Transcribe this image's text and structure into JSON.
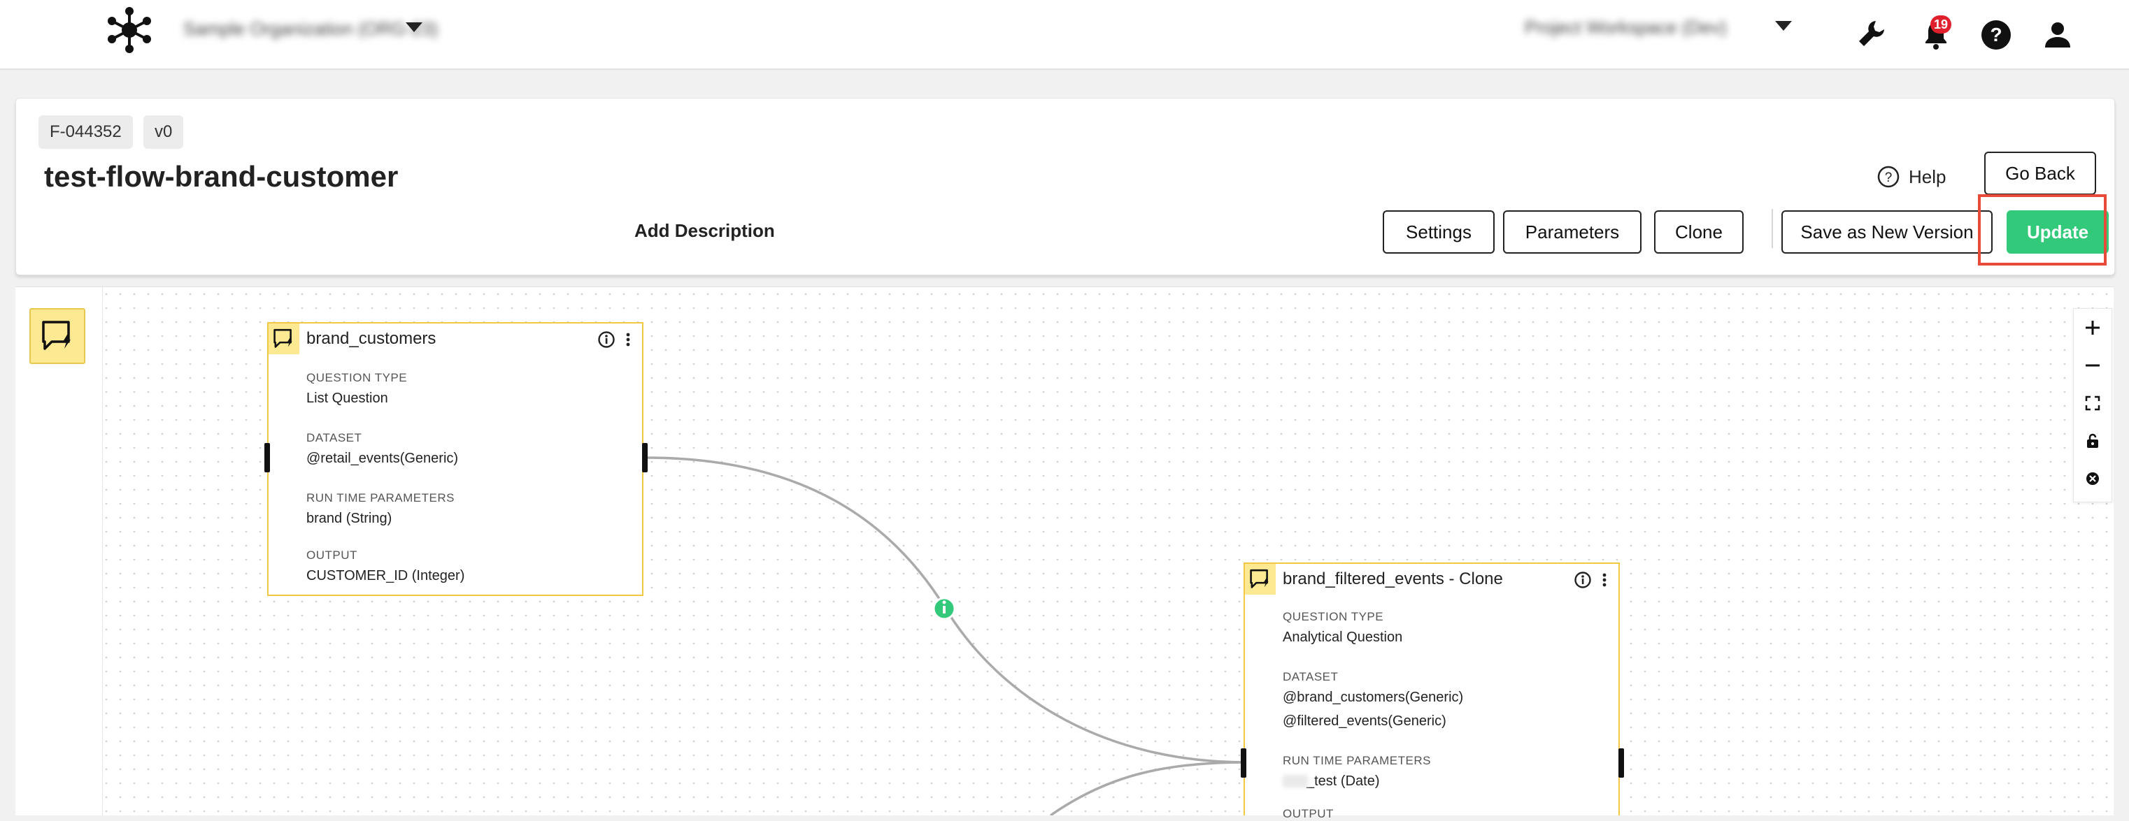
{
  "topbar": {
    "workspace_name": "Sample Organization (ORG-23)",
    "account_name": "Project Workspace (Dev)",
    "notification_count": "19",
    "icons": [
      "logo-icon",
      "wrench-icon",
      "bell-icon",
      "help-icon",
      "user-icon"
    ]
  },
  "flow": {
    "id_tag": "F-044352",
    "version_tag": "v0",
    "title": "test-flow-brand-customer",
    "add_description": "Add Description",
    "help_label": "Help",
    "buttons": {
      "go_back": "Go Back",
      "settings": "Settings",
      "parameters": "Parameters",
      "clone": "Clone",
      "save_as_new_version": "Save as New Version",
      "update": "Update"
    }
  },
  "canvas": {
    "nodes": [
      {
        "title": "brand_customers",
        "fields": [
          {
            "label": "QUESTION TYPE",
            "values": [
              "List Question"
            ]
          },
          {
            "label": "DATASET",
            "values": [
              "@retail_events(Generic)"
            ]
          },
          {
            "label": "RUN TIME PARAMETERS",
            "values": [
              "brand (String)"
            ]
          },
          {
            "label": "OUTPUT",
            "values": [
              "CUSTOMER_ID (Integer)"
            ]
          }
        ]
      },
      {
        "title": "brand_filtered_events - Clone",
        "fields": [
          {
            "label": "QUESTION TYPE",
            "values": [
              "Analytical Question"
            ]
          },
          {
            "label": "DATASET",
            "values": [
              "@brand_customers(Generic)",
              "@filtered_events(Generic)"
            ]
          },
          {
            "label": "RUN TIME PARAMETERS",
            "values": [
              "_test (Date)"
            ]
          },
          {
            "label": "OUTPUT",
            "values": []
          }
        ]
      }
    ],
    "zoom_controls": [
      "zoom-in-icon",
      "zoom-out-icon",
      "fit-view-icon",
      "lock-icon",
      "reset-icon"
    ]
  },
  "colors": {
    "update_button": "#32c97a",
    "highlight": "#e84a3a",
    "node_border": "#f2c744",
    "node_icon_bg": "#fde992",
    "notification_badge": "#e0202c"
  }
}
